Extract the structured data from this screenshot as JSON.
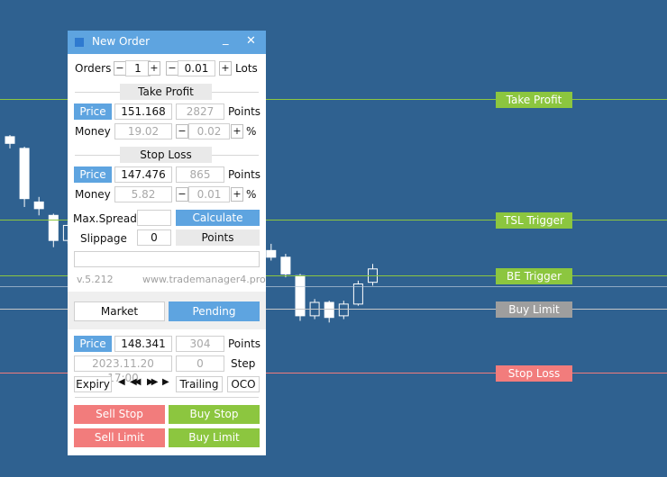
{
  "window": {
    "title": "New Order",
    "minimize_glyph": "_",
    "close_glyph": "✕"
  },
  "orders": {
    "label": "Orders",
    "count": "1",
    "lots_value": "0.01",
    "lots_label": "Lots",
    "minus": "−",
    "plus": "+"
  },
  "take_profit": {
    "section_label": "Take Profit",
    "price_button": "Price",
    "price_value": "151.168",
    "points_value": "2827",
    "points_label": "Points",
    "money_label": "Money",
    "money_value": "19.02",
    "percent_value": "0.02",
    "percent_label": "%"
  },
  "stop_loss": {
    "section_label": "Stop Loss",
    "price_button": "Price",
    "price_value": "147.476",
    "points_value": "865",
    "points_label": "Points",
    "money_label": "Money",
    "money_value": "5.82",
    "percent_value": "0.01",
    "percent_label": "%"
  },
  "settings": {
    "max_spread_label": "Max.Spread",
    "max_spread_value": "",
    "calculate_button": "Calculate",
    "slippage_label": "Slippage",
    "slippage_value": "0",
    "points_button": "Points",
    "comment_value": ""
  },
  "info": {
    "version": "v.5.212",
    "website": "www.trademanager4.pro"
  },
  "mode_tabs": {
    "market": "Market",
    "pending": "Pending"
  },
  "pending": {
    "price_button": "Price",
    "price_value": "148.341",
    "points_value": "304",
    "points_label": "Points",
    "expiry_date": "2023.11.20 17:00",
    "step_value": "0",
    "step_label": "Step",
    "expiry_button": "Expiry",
    "nav_first": "◀",
    "nav_prev": "◀◀",
    "nav_next": "▶▶",
    "nav_last": "▶",
    "trailing_button": "Trailing",
    "oco_button": "OCO"
  },
  "actions": {
    "sell_stop": "Sell Stop",
    "buy_stop": "Buy Stop",
    "sell_limit": "Sell Limit",
    "buy_limit": "Buy Limit"
  },
  "chart_lines": {
    "take_profit": "Take Profit",
    "tsl_trigger": "TSL Trigger",
    "be_trigger": "BE Trigger",
    "buy_limit": "Buy Limit",
    "stop_loss": "Stop Loss"
  },
  "colors": {
    "background": "#2f6190",
    "accent_blue": "#5ea4e0",
    "green": "#8cc63f",
    "red": "#f27c7c",
    "grey_tag": "#9e9e9e",
    "candle": "#ffffff"
  },
  "candles": [
    {
      "o": 152.2,
      "h": 152.3,
      "l": 151.5,
      "c": 151.8
    },
    {
      "o": 151.5,
      "h": 151.6,
      "l": 148.0,
      "c": 148.5
    },
    {
      "o": 148.3,
      "h": 148.6,
      "l": 147.5,
      "c": 147.9
    },
    {
      "o": 147.5,
      "h": 147.6,
      "l": 145.6,
      "c": 146.0
    },
    {
      "o": 146.0,
      "h": 147.1,
      "l": 145.8,
      "c": 146.9
    },
    {
      "o": 146.9,
      "h": 147.0,
      "l": 146.2,
      "c": 146.4
    },
    {
      "o": 146.3,
      "h": 147.3,
      "l": 146.1,
      "c": 147.1
    },
    {
      "o": 147.1,
      "h": 147.6,
      "l": 145.6,
      "c": 146.0
    },
    {
      "o": 146.0,
      "h": 146.6,
      "l": 145.6,
      "c": 145.8
    },
    {
      "o": 145.9,
      "h": 147.0,
      "l": 145.5,
      "c": 146.8
    },
    {
      "o": 147.0,
      "h": 147.6,
      "l": 146.3,
      "c": 146.5
    },
    {
      "o": 146.5,
      "h": 147.5,
      "l": 145.9,
      "c": 147.3
    },
    {
      "o": 147.3,
      "h": 147.4,
      "l": 144.3,
      "c": 144.5
    },
    {
      "o": 144.5,
      "h": 144.7,
      "l": 143.5,
      "c": 143.8
    },
    {
      "o": 143.8,
      "h": 144.4,
      "l": 143.5,
      "c": 144.2
    },
    {
      "o": 144.2,
      "h": 144.3,
      "l": 143.0,
      "c": 143.2
    },
    {
      "o": 143.2,
      "h": 144.6,
      "l": 143.0,
      "c": 144.4
    },
    {
      "o": 144.4,
      "h": 145.6,
      "l": 144.2,
      "c": 145.4
    },
    {
      "o": 145.4,
      "h": 145.8,
      "l": 144.8,
      "c": 145.0
    },
    {
      "o": 145.0,
      "h": 145.2,
      "l": 143.8,
      "c": 144.0
    },
    {
      "o": 143.9,
      "h": 144.0,
      "l": 141.2,
      "c": 141.5
    },
    {
      "o": 141.5,
      "h": 142.5,
      "l": 141.3,
      "c": 142.3
    },
    {
      "o": 142.3,
      "h": 142.4,
      "l": 141.1,
      "c": 141.4
    },
    {
      "o": 141.5,
      "h": 142.4,
      "l": 141.3,
      "c": 142.2
    },
    {
      "o": 142.2,
      "h": 143.6,
      "l": 142.1,
      "c": 143.4
    },
    {
      "o": 143.5,
      "h": 144.6,
      "l": 143.3,
      "c": 144.3
    }
  ]
}
